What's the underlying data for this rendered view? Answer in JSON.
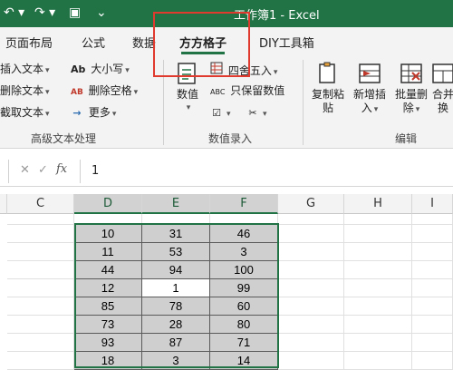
{
  "title_bar": {
    "title": "工作簿1  -  Excel",
    "quick_access": [
      "undo-icon",
      "redo-icon",
      "print-preview-icon",
      "customize-qat-icon"
    ]
  },
  "tabs": [
    {
      "label": "页面布局"
    },
    {
      "label": "公式"
    },
    {
      "label": "数据"
    },
    {
      "label": "方方格子",
      "active": true
    },
    {
      "label": "DIY工具箱"
    }
  ],
  "ribbon": {
    "text_group": {
      "items": [
        "插入文本",
        "删除文本",
        "截取文本"
      ],
      "label": "高级文本处理",
      "col2": [
        "大小写",
        "删除空格",
        "更多"
      ],
      "ab_icon": "Ab",
      "ab_icon2": "AB"
    },
    "numeric_group": {
      "big_label": "数值",
      "round_label": "四舍五入",
      "keep_label": "只保留数值",
      "keep_icon": "ABC",
      "label": "数值录入"
    },
    "edit_group": {
      "copy_label": [
        "复制粘",
        "贴"
      ],
      "insert_label": [
        "新增插",
        "入"
      ],
      "delete_label": [
        "批量删",
        "除"
      ],
      "merge_label": [
        "合并",
        "换"
      ],
      "label": "编辑"
    }
  },
  "formula_bar": {
    "cancel_icon": "✕",
    "confirm_icon": "✓",
    "fx_label": "fx",
    "value": "1"
  },
  "grid": {
    "columns": [
      "C",
      "D",
      "E",
      "F",
      "G",
      "H",
      "I"
    ],
    "selected_columns": [
      "D",
      "E",
      "F"
    ],
    "rows": [
      [
        "10",
        "31",
        "46"
      ],
      [
        "11",
        "53",
        "3"
      ],
      [
        "44",
        "94",
        "100"
      ],
      [
        "12",
        "1",
        "99"
      ],
      [
        "85",
        "78",
        "60"
      ],
      [
        "73",
        "28",
        "80"
      ],
      [
        "93",
        "87",
        "71"
      ],
      [
        "18",
        "3",
        "14"
      ]
    ],
    "active_cell": {
      "row": 3,
      "col": 1
    }
  },
  "colors": {
    "accent": "#217346",
    "highlight_box": "#e03a2f",
    "selected_range_fill": "#cfcfcf"
  }
}
